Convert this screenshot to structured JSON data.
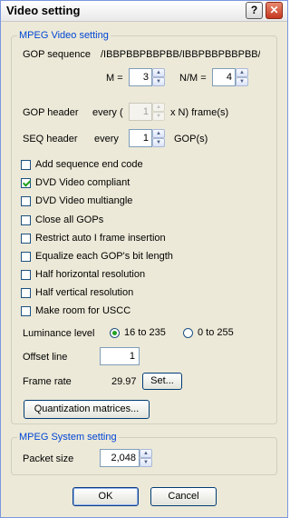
{
  "window": {
    "title": "Video setting",
    "help_glyph": "?",
    "close_glyph": "✕"
  },
  "mpeg_video": {
    "legend": "MPEG Video setting",
    "gop_sequence_label": "GOP sequence",
    "gop_sequence_value": "/IBBPBBPBBPBB/IBBPBBPBBPBB/",
    "m_label": "M =",
    "m_value": "3",
    "nm_label": "N/M =",
    "nm_value": "4",
    "gop_header_label": "GOP header",
    "gop_header_every": "every (",
    "gop_header_value": "1",
    "gop_header_suffix": "x N) frame(s)",
    "seq_header_label": "SEQ header",
    "seq_header_every": "every",
    "seq_header_value": "1",
    "seq_header_suffix": "GOP(s)",
    "checkboxes": [
      {
        "label": "Add sequence end code",
        "checked": false
      },
      {
        "label": "DVD Video compliant",
        "checked": true
      },
      {
        "label": "DVD Video multiangle",
        "checked": false
      },
      {
        "label": "Close all GOPs",
        "checked": false
      },
      {
        "label": "Restrict auto I frame insertion",
        "checked": false
      },
      {
        "label": "Equalize each GOP's bit length",
        "checked": false
      },
      {
        "label": "Half horizontal resolution",
        "checked": false
      },
      {
        "label": "Half vertical resolution",
        "checked": false
      },
      {
        "label": "Make room for USCC",
        "checked": false
      }
    ],
    "luminance_label": "Luminance level",
    "luminance_options": [
      {
        "label": "16 to 235",
        "selected": true
      },
      {
        "label": "0 to 255",
        "selected": false
      }
    ],
    "offset_line_label": "Offset line",
    "offset_line_value": "1",
    "frame_rate_label": "Frame rate",
    "frame_rate_value": "29.97",
    "set_button": "Set...",
    "quant_button": "Quantization matrices..."
  },
  "mpeg_system": {
    "legend": "MPEG System setting",
    "packet_size_label": "Packet size",
    "packet_size_value": "2,048"
  },
  "footer": {
    "ok": "OK",
    "cancel": "Cancel"
  },
  "icons": {
    "spin_up": "▲",
    "spin_down": "▼"
  }
}
